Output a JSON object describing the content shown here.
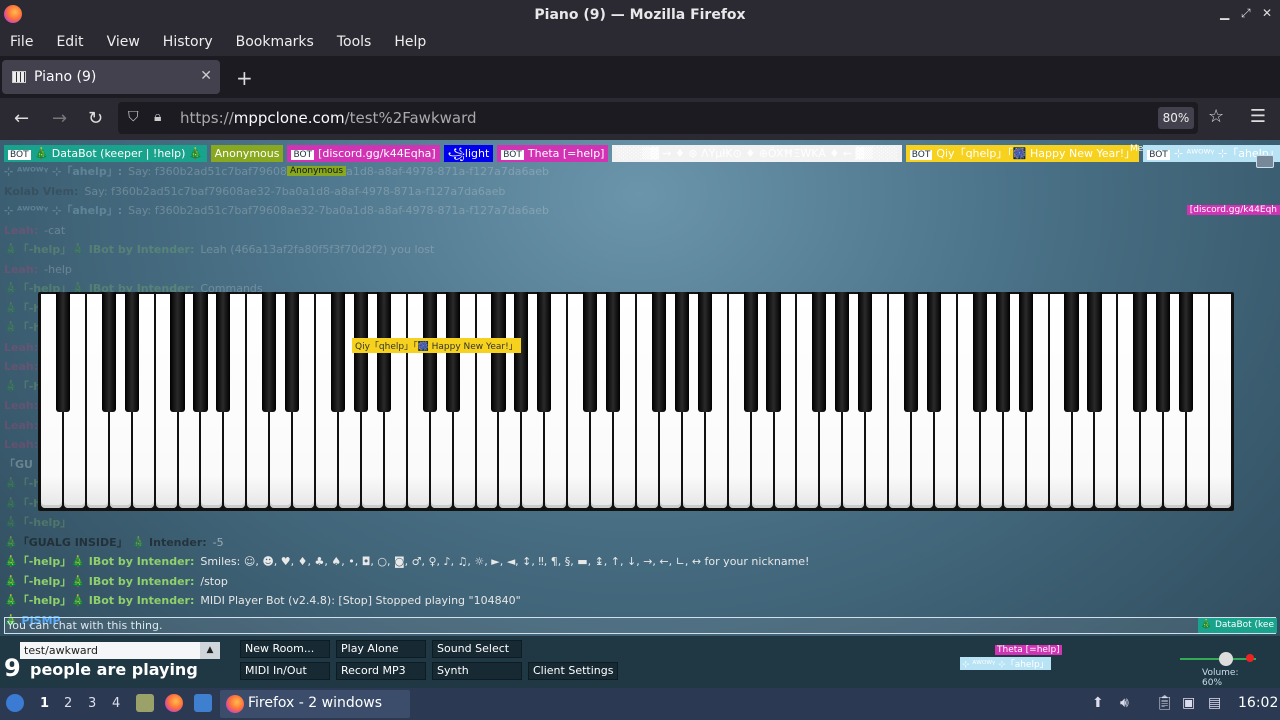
{
  "window": {
    "title": "Piano (9) — Mozilla Firefox"
  },
  "menu": [
    "File",
    "Edit",
    "View",
    "History",
    "Bookmarks",
    "Tools",
    "Help"
  ],
  "tab": {
    "label": "Piano (9)"
  },
  "nav": {
    "url_domain": "mppclone.com",
    "url_prefix": "https://",
    "url_path": "/test%2Fawkward",
    "zoom": "80%"
  },
  "users": [
    {
      "bot": true,
      "name": "🎄 DataBot (keeper | !help) 🎄",
      "bg": "#1aa38c",
      "fg": "#ffffff"
    },
    {
      "bot": false,
      "name": "Anonymous",
      "bg": "#88a820",
      "fg": "#ffffff"
    },
    {
      "bot": true,
      "name": "[discord.gg/k44Eqha]",
      "bg": "#d233b5",
      "fg": "#ffffff"
    },
    {
      "bot": false,
      "name": "꧁light",
      "bg": "#0000ee",
      "fg": "#ffffff"
    },
    {
      "bot": true,
      "name": "Theta [=help]",
      "bg": "#d233b5",
      "fg": "#ffffff"
    },
    {
      "bot": false,
      "name": "░░░▒▓ ⇝ ♦ ⊛ ΛΫμłK⊙ ♦ ⊕ÖXĦΞWKÄ ♦ ⇜ ▓▒░░░",
      "bg": "#f2f2f2",
      "fg": "#ffffff"
    },
    {
      "bot": true,
      "name": "Qiy「qhelp」「🎆 Happy New Year!」",
      "bg": "#f6d21e",
      "fg": "#ffffff"
    },
    {
      "bot": true,
      "name": "⊹ ᴬᵂᴼᵂᵞ ⊹「ahelp」",
      "bg": "#b8e3f5",
      "fg": "#ffffff"
    },
    {
      "bot": false,
      "name": "Kolab Vlem",
      "bg": "#000000",
      "fg": "#ffffff"
    }
  ],
  "tags": {
    "anonymous": "Anonymous",
    "me": "Me",
    "discord_right": "[discord.gg/k44Eqh",
    "cursor_qiy": "Qiy「qhelp」「🎆 Happy New Year!」"
  },
  "chat": [
    {
      "name": "⊹ ᴬᵂᴼᵂᵞ ⊹「ahelp」:",
      "text": "Say: f360b2ad51c7baf79608ae32-7ba0a1d8-a8af-4978-871a-f127a7da6aeb",
      "color": "#b8e3f5",
      "cls": "fade"
    },
    {
      "name": "Kolab Vlem:",
      "text": "Say: f360b2ad51c7baf79608ae32-7ba0a1d8-a8af-4978-871a-f127a7da6aeb",
      "color": "#222222",
      "cls": "fade"
    },
    {
      "name": "⊹ ᴬᵂᴼᵂᵞ ⊹「ahelp」:",
      "text": "Say: f360b2ad51c7baf79608ae32-7ba0a1d8-a8af-4978-871a-f127a7da6aeb",
      "color": "#b8e3f5",
      "cls": "fade"
    },
    {
      "name": "Leah:",
      "text": "-cat",
      "color": "#e23a7a",
      "cls": "fade"
    },
    {
      "name": "🎄「-help」🎄 IBot by Intender:",
      "text": "Leah (466a13af2fa80f5f3f70d2f2) you lost",
      "color": "#8fd16a",
      "cls": "fade"
    },
    {
      "name": "Leah:",
      "text": "-help",
      "color": "#e23a7a",
      "cls": "fade"
    },
    {
      "name": "🎄「-help」🎄 IBot by Intender:",
      "text": "Commands",
      "color": "#8fd16a",
      "cls": "fade"
    },
    {
      "name": "🎄「-help」",
      "text": "",
      "color": "#8fd16a",
      "cls": "fade"
    },
    {
      "name": "🎄「-help」",
      "text": "",
      "color": "#8fd16a",
      "cls": "fade"
    },
    {
      "name": "Leah:",
      "text": "",
      "color": "#e23a7a",
      "cls": "fade"
    },
    {
      "name": "Leah:",
      "text": "",
      "color": "#e23a7a",
      "cls": "fade"
    },
    {
      "name": "🎄「-help」",
      "text": "",
      "color": "#8fd16a",
      "cls": "fade"
    },
    {
      "name": "Leah:",
      "text": "",
      "color": "#e23a7a",
      "cls": "fade"
    },
    {
      "name": "Leah:",
      "text": "",
      "color": "#e23a7a",
      "cls": "fade"
    },
    {
      "name": "Leah:",
      "text": "",
      "color": "#e23a7a",
      "cls": "fade"
    },
    {
      "name": "「GU",
      "text": "",
      "color": "#ffffff",
      "cls": "fade"
    },
    {
      "name": "🎄「-help」",
      "text": "",
      "color": "#8fd16a",
      "cls": "fade"
    },
    {
      "name": "🎄「-help」",
      "text": "",
      "color": "#8fd16a",
      "cls": "fade"
    },
    {
      "name": "🎄「-help」",
      "text": "",
      "color": "#8fd16a",
      "cls": "fade"
    },
    {
      "name": "🎄「GUALG INSIDE」 🎄 Intender:",
      "text": "-5",
      "color": "#111111",
      "cls": "midfade"
    },
    {
      "name": "🎄「-help」🎄 IBot by Intender:",
      "text": "Smiles: ☺, ☻, ♥, ♦, ♣, ♠, •, ◘, ○, ◙, ♂, ♀, ♪, ♫, ☼, ►, ◄, ↕, ‼, ¶, §, ▬, ↨, ↑, ↓, →, ←, ∟, ↔ for your nickname!",
      "color": "#8fd16a",
      "cls": ""
    },
    {
      "name": "🎄「-help」🎄 IBot by Intender:",
      "text": "/stop",
      "color": "#8fd16a",
      "cls": ""
    },
    {
      "name": "🎄「-help」🎄 IBot by Intender:",
      "text": "MIDI Player Bot (v2.4.8): [Stop] Stopped playing \"104840\"",
      "color": "#8fd16a",
      "cls": ""
    },
    {
      "name": "🎄 PJSMP",
      "text": "",
      "color": "#4aa8ff",
      "cls": ""
    }
  ],
  "chat_input": {
    "placeholder": "You can chat with this thing.",
    "right_tag": "🎄 DataBot (kee"
  },
  "controls": {
    "room": "test/awkward",
    "player_count": "9",
    "player_label": "people are playing",
    "buttons": [
      "New Room...",
      "Play Alone",
      "Sound Select",
      "MIDI In/Out",
      "Record MP3",
      "Synth",
      "Client Settings"
    ],
    "theta": "Theta [=help]",
    "awony": "⊹ ᴬᵂᴼᵂᵞ ⊹「ahelp」",
    "volume_label": "Volume: 60%",
    "volume": 0.6
  },
  "taskbar": {
    "workspaces": [
      "1",
      "2",
      "3",
      "4"
    ],
    "active_workspace": "1",
    "window_label": "Firefox - 2 windows",
    "clock": "16:02"
  },
  "colors": {
    "accent": "#ff7139",
    "page_bg": "#4b7389",
    "chrome": "#2b2a33"
  }
}
